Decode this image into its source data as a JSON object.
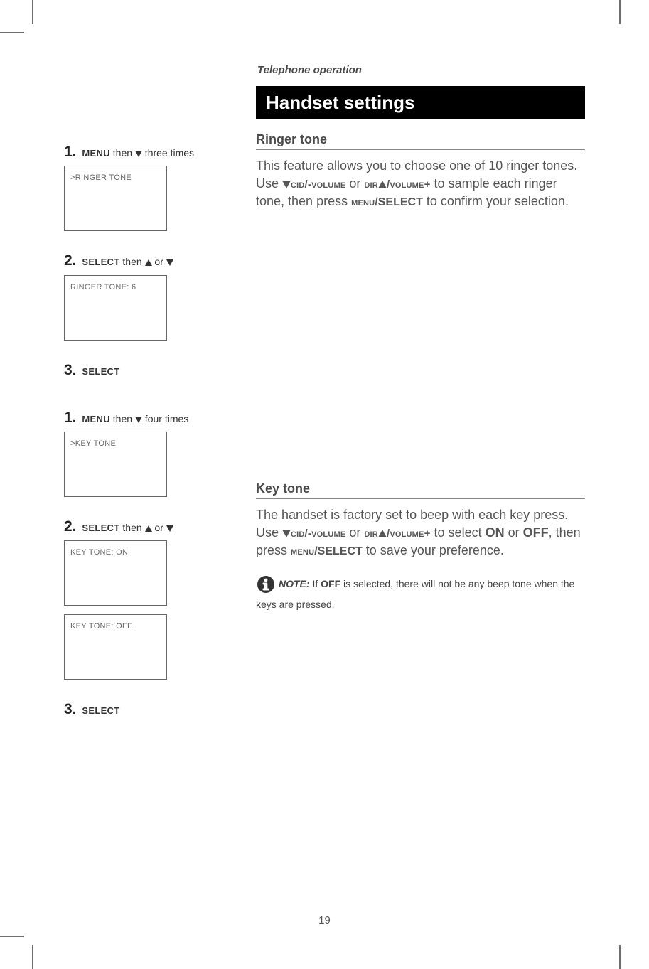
{
  "header": {
    "section": "Telephone operation",
    "title": "Handset settings"
  },
  "ringer": {
    "heading": "Ringer tone",
    "para_a": "This feature allows you to choose one of 10 ringer tones. Use ",
    "cid": "cid/-volume",
    "or": " or ",
    "dir": "dir",
    "vol": "/volume+",
    "para_b": " to sample each ringer tone, then press ",
    "menu": "menu",
    "select": "/SELECT",
    "para_c": " to confirm your selection."
  },
  "key": {
    "heading": "Key tone",
    "para_a": "The handset is factory set to beep with each key press. Use ",
    "cid": "cid/-volume",
    "or": " or ",
    "dir": "dir",
    "vol": "/volume+",
    "para_b": " to select ",
    "on": "ON",
    "or2": " or ",
    "off": "OFF",
    "para_c": ", then press ",
    "menu": "menu",
    "select": "/SELECT",
    "para_d": " to save your preference.",
    "note_label": "NOTE:",
    "note_a": " If ",
    "note_off": "OFF",
    "note_b": " is selected, there will not be any beep tone when the keys are pressed."
  },
  "steps_ringer": {
    "s1_num": "1.",
    "s1_a": "MENU",
    "s1_b": " then ",
    "s1_c": " three times",
    "screen1": ">RINGER TONE",
    "s2_num": "2.",
    "s2_a": "SELECT",
    "s2_b": " then ",
    "s2_c": "or",
    "screen2": "RINGER TONE: 6",
    "s3_num": "3.",
    "s3_a": "SELECT"
  },
  "steps_key": {
    "s1_num": "1.",
    "s1_a": "MENU",
    "s1_b": " then ",
    "s1_c": " four times",
    "screen1": ">KEY TONE",
    "s2_num": "2.",
    "s2_a": "SELECT",
    "s2_b": " then ",
    "s2_c": "or",
    "screen2a": "KEY TONE:  ON",
    "screen2b": "KEY TONE:  OFF",
    "s3_num": "3.",
    "s3_a": "SELECT"
  },
  "page_number": "19"
}
